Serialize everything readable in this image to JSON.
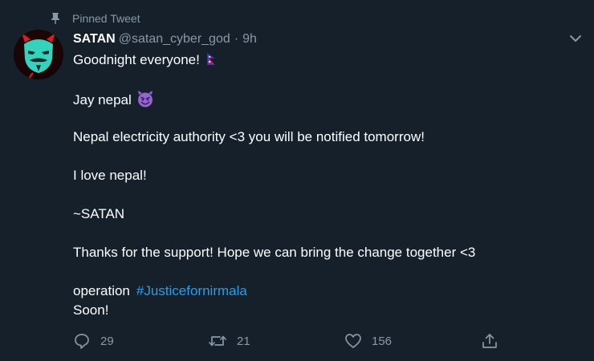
{
  "tweet": {
    "pinned_label": "Pinned Tweet",
    "display_name": "SATAN",
    "handle": "@satan_cyber_god",
    "separator": "·",
    "time": "9h",
    "lines": {
      "l1": "Goodnight everyone!",
      "l2": "Jay nepal",
      "l3": "Nepal electricity authority <3 you will be notified tomorrow!",
      "l4": "I love nepal!",
      "l5": "~SATAN",
      "l6": "Thanks for the support! Hope we can bring the change together <3",
      "l7_prefix": "operation",
      "l7_hashtag": "#Justicefornirmala",
      "l8": "Soon!"
    },
    "emoji": {
      "flag": "nepal-flag-icon",
      "devil": "smiling-devil-icon"
    }
  },
  "actions": {
    "reply_count": "29",
    "retweet_count": "21",
    "like_count": "156"
  },
  "colors": {
    "background": "#15202b",
    "text": "#ffffff",
    "secondary": "#8899a6",
    "link": "#1da1f2",
    "devil_purple": "#9266cc"
  }
}
